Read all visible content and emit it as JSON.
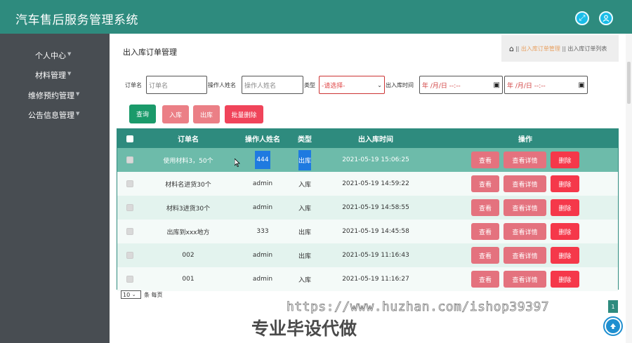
{
  "app": {
    "title": "汽车售后服务管理系统"
  },
  "topbar": {
    "fullscreen_icon": "expand-icon",
    "user_icon": "user-icon"
  },
  "sidebar": {
    "items": [
      {
        "label": "个人中心"
      },
      {
        "label": "材料管理"
      },
      {
        "label": "维修预约管理"
      },
      {
        "label": "公告信息管理"
      }
    ]
  },
  "page": {
    "title": "出入库订单管理",
    "breadcrumb": {
      "sep": "||",
      "current": "出入库订单管理",
      "tail": "出入库订单列表"
    }
  },
  "filters": {
    "order_label": "订单名",
    "order_placeholder": "订单名",
    "operator_label": "操作人姓名",
    "operator_placeholder": "操作人姓名",
    "type_label": "类型",
    "type_value": "-请选择-",
    "time_label": "出入库时间",
    "date_start": "年 /月/日 --:--",
    "date_end": "年 /月/日 --:--"
  },
  "buttons": {
    "query": "查询",
    "in": "入库",
    "out": "出库",
    "batch_delete": "批量删除"
  },
  "table": {
    "headers": {
      "name": "订单名",
      "operator": "操作人姓名",
      "type": "类型",
      "time": "出入库时间",
      "actions": "操作"
    },
    "actions": {
      "view": "查看",
      "detail": "查看详情",
      "delete": "删除"
    },
    "rows": [
      {
        "name": "使用材料3，50个",
        "operator": "444",
        "type": "出库",
        "time": "2021-05-19 15:06:25"
      },
      {
        "name": "材料名进货30个",
        "operator": "admin",
        "type": "入库",
        "time": "2021-05-19 14:59:22"
      },
      {
        "name": "材料3进货30个",
        "operator": "admin",
        "type": "入库",
        "time": "2021-05-19 14:58:55"
      },
      {
        "name": "出库到xxx地方",
        "operator": "333",
        "type": "出库",
        "time": "2021-05-19 14:45:58"
      },
      {
        "name": "002",
        "operator": "admin",
        "type": "出库",
        "time": "2021-05-19 11:16:43"
      },
      {
        "name": "001",
        "operator": "admin",
        "type": "入库",
        "time": "2021-05-19 11:16:27"
      }
    ]
  },
  "pager": {
    "page_size": "10",
    "suffix": "条 每页",
    "current_page": "1"
  },
  "watermark": {
    "url": "https://www.huzhan.com/ishop39397",
    "text": "专业毕设代做"
  },
  "colors": {
    "primary": "#2e8b7e",
    "sidebar": "#484d52",
    "danger": "#f5384a",
    "pink": "#e4727e"
  }
}
